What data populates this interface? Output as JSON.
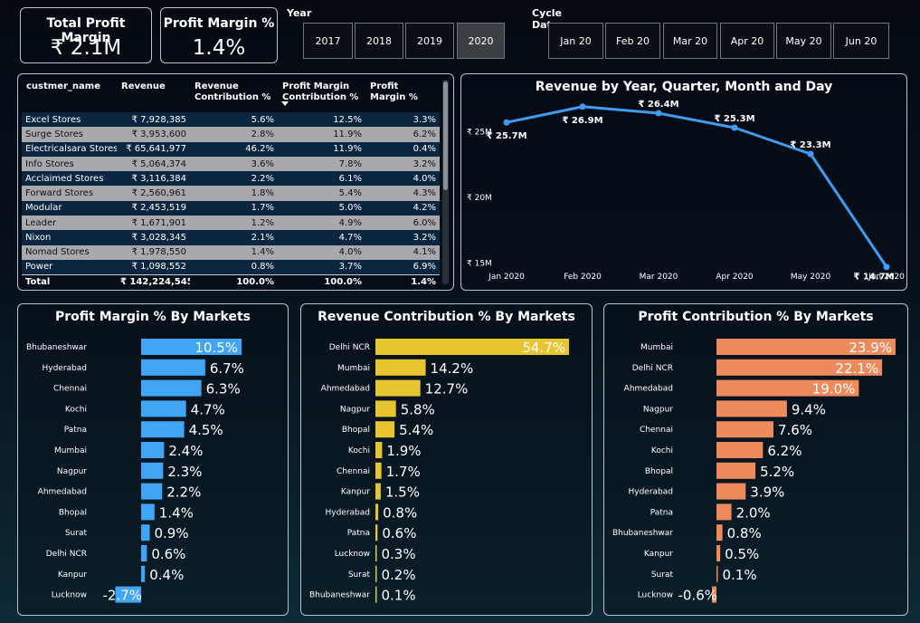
{
  "kpis": {
    "total_profit_margin": {
      "title": "Total Profit Margin",
      "value": "₹ 2.1M"
    },
    "profit_margin_pct": {
      "title": "Profit Margin %",
      "value": "1.4%"
    }
  },
  "year_slicer": {
    "title": "Year",
    "options": [
      "2017",
      "2018",
      "2019",
      "2020"
    ],
    "selected": "2020"
  },
  "cycle_slicer": {
    "title": "Cycle Date",
    "options": [
      "Jan 20",
      "Feb 20",
      "Mar 20",
      "Apr 20",
      "May 20",
      "Jun 20"
    ]
  },
  "table": {
    "headers": [
      "custmer_name",
      "Revenue",
      "Revenue Contribution %",
      "Profit Margin Contribution %",
      "Profit Margin %"
    ],
    "rows": [
      [
        "Excel Stores",
        "₹ 7,928,385",
        "5.6%",
        "12.5%",
        "3.3%"
      ],
      [
        "Surge Stores",
        "₹ 3,953,600",
        "2.8%",
        "11.9%",
        "6.2%"
      ],
      [
        "Electricalsara Stores",
        "₹ 65,641,977",
        "46.2%",
        "11.9%",
        "0.4%"
      ],
      [
        "Info Stores",
        "₹ 5,064,374",
        "3.6%",
        "7.8%",
        "3.2%"
      ],
      [
        "Acclaimed Stores",
        "₹ 3,116,384",
        "2.2%",
        "6.1%",
        "4.0%"
      ],
      [
        "Forward Stores",
        "₹ 2,560,961",
        "1.8%",
        "5.4%",
        "4.3%"
      ],
      [
        "Modular",
        "₹ 2,453,519",
        "1.7%",
        "5.0%",
        "4.2%"
      ],
      [
        "Leader",
        "₹ 1,671,901",
        "1.2%",
        "4.9%",
        "6.0%"
      ],
      [
        "Nixon",
        "₹ 3,028,345",
        "2.1%",
        "4.7%",
        "3.2%"
      ],
      [
        "Nomad Stores",
        "₹ 1,978,550",
        "1.4%",
        "4.0%",
        "4.1%"
      ],
      [
        "Power",
        "₹ 1,098,552",
        "0.8%",
        "3.7%",
        "6.9%"
      ]
    ],
    "total": [
      "Total",
      "₹ 142,224,545",
      "100.0%",
      "100.0%",
      "1.4%"
    ]
  },
  "chart_data": [
    {
      "type": "line",
      "title": "Revenue by Year, Quarter, Month and Day",
      "x": [
        "Jan 2020",
        "Feb 2020",
        "Mar 2020",
        "Apr 2020",
        "May 2020",
        "Jun 2020"
      ],
      "values": [
        25.7,
        26.9,
        26.4,
        25.3,
        23.3,
        14.7
      ],
      "data_labels": [
        "₹ 25.7M",
        "₹ 26.9M",
        "₹ 26.4M",
        "₹ 25.3M",
        "₹ 23.3M",
        "₹ 14.7M"
      ],
      "y_ticks": [
        15,
        20,
        25
      ],
      "y_tick_labels": [
        "₹ 15M",
        "₹ 20M",
        "₹ 25M"
      ],
      "ylim": [
        14.2,
        27.3
      ],
      "color": "#3f9cf0",
      "grid": false
    },
    {
      "type": "bar",
      "orientation": "horizontal",
      "title": "Profit Margin % By Markets",
      "categories": [
        "Bhubaneshwar",
        "Hyderabad",
        "Chennai",
        "Kochi",
        "Patna",
        "Mumbai",
        "Nagpur",
        "Ahmedabad",
        "Bhopal",
        "Surat",
        "Delhi NCR",
        "Kanpur",
        "Lucknow"
      ],
      "values": [
        10.5,
        6.7,
        6.3,
        4.7,
        4.5,
        2.4,
        2.3,
        2.2,
        1.4,
        0.9,
        0.6,
        0.4,
        -2.7
      ],
      "labels": [
        "10.5%",
        "6.7%",
        "6.3%",
        "4.7%",
        "4.5%",
        "2.4%",
        "2.3%",
        "2.2%",
        "1.4%",
        "0.9%",
        "0.6%",
        "0.4%",
        "-2.7%"
      ],
      "color": "#41a5f5"
    },
    {
      "type": "bar",
      "orientation": "horizontal",
      "title": "Revenue Contribution % By Markets",
      "categories": [
        "Delhi NCR",
        "Mumbai",
        "Ahmedabad",
        "Nagpur",
        "Bhopal",
        "Kochi",
        "Chennai",
        "Kanpur",
        "Hyderabad",
        "Patna",
        "Lucknow",
        "Surat",
        "Bhubaneshwar"
      ],
      "values": [
        54.7,
        14.2,
        12.7,
        5.8,
        5.4,
        1.9,
        1.7,
        1.5,
        0.8,
        0.6,
        0.3,
        0.2,
        0.1
      ],
      "labels": [
        "54.7%",
        "14.2%",
        "12.7%",
        "5.8%",
        "5.4%",
        "1.9%",
        "1.7%",
        "1.5%",
        "0.8%",
        "0.6%",
        "0.3%",
        "0.2%",
        "0.1%"
      ],
      "color": "#e6c531"
    },
    {
      "type": "bar",
      "orientation": "horizontal",
      "title": "Profit Contribution % By Markets",
      "categories": [
        "Mumbai",
        "Delhi NCR",
        "Ahmedabad",
        "Nagpur",
        "Chennai",
        "Kochi",
        "Bhopal",
        "Hyderabad",
        "Patna",
        "Bhubaneshwar",
        "Kanpur",
        "Surat",
        "Lucknow"
      ],
      "values": [
        23.9,
        22.1,
        19.0,
        9.4,
        7.6,
        6.2,
        5.2,
        3.9,
        2.0,
        0.8,
        0.5,
        0.1,
        -0.6
      ],
      "labels": [
        "23.9%",
        "22.1%",
        "19.0%",
        "9.4%",
        "7.6%",
        "6.2%",
        "5.2%",
        "3.9%",
        "2.0%",
        "0.8%",
        "0.5%",
        "0.1%",
        "-0.6%"
      ],
      "color": "#ee8b5d"
    }
  ]
}
